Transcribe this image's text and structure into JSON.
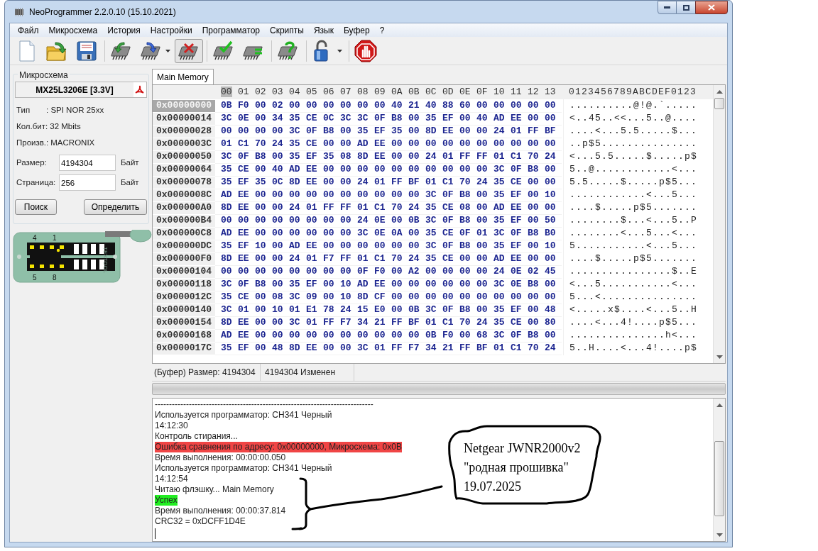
{
  "window": {
    "title": "NeoProgrammer 2.2.0.10 (15.10.2021)"
  },
  "menu": [
    "Файл",
    "Микросхема",
    "История",
    "Настройки",
    "Программатор",
    "Скрипты",
    "Язык",
    "Буфер",
    "?"
  ],
  "toolbar": [
    [
      {
        "kind": "new",
        "dropdown": false,
        "pressed": false
      },
      {
        "kind": "open",
        "dropdown": false,
        "pressed": false
      },
      {
        "kind": "save",
        "dropdown": false,
        "pressed": false
      }
    ],
    [
      {
        "kind": "read",
        "dropdown": false,
        "pressed": false
      },
      {
        "kind": "write",
        "dropdown": true,
        "pressed": false
      },
      {
        "kind": "erase",
        "dropdown": false,
        "pressed": true
      }
    ],
    [
      {
        "kind": "verify",
        "dropdown": false,
        "pressed": false
      },
      {
        "kind": "compare",
        "dropdown": false,
        "pressed": false
      }
    ],
    [
      {
        "kind": "detect",
        "dropdown": false,
        "pressed": false
      }
    ],
    [
      {
        "kind": "protect",
        "dropdown": true,
        "pressed": false
      }
    ],
    [
      {
        "kind": "stop",
        "dropdown": false,
        "pressed": false
      }
    ]
  ],
  "chip_panel": {
    "legend": "Микросхема",
    "chip_name": "MX25L3206E [3.3V]",
    "info": [
      {
        "label": "Тип",
        "value": ": SPI NOR  25xx"
      },
      {
        "label": "Кол.бит:",
        "value": "32 Mbits"
      },
      {
        "label": "Произв.:",
        "value": "MACRONIX"
      }
    ],
    "fields": [
      {
        "label": "Размер:",
        "value": "4194304",
        "unit": "Байт"
      },
      {
        "label": "Страница:",
        "value": "256",
        "unit": "Байт"
      }
    ],
    "buttons": [
      "Поиск",
      "Определить"
    ],
    "socket": {
      "pin_labels": [
        "4",
        "1",
        "5",
        "8"
      ],
      "brand": "TEXTOOL"
    }
  },
  "tabs": [
    {
      "label": "Main Memory",
      "selected": true
    }
  ],
  "hex_view": {
    "columns": [
      {
        "label": "00",
        "selected": true
      },
      {
        "label": "01",
        "selected": false
      },
      {
        "label": "02",
        "selected": false
      },
      {
        "label": "03",
        "selected": false
      },
      {
        "label": "04",
        "selected": false
      },
      {
        "label": "05",
        "selected": false
      },
      {
        "label": "06",
        "selected": false
      },
      {
        "label": "07",
        "selected": false
      },
      {
        "label": "08",
        "selected": false
      },
      {
        "label": "09",
        "selected": false
      },
      {
        "label": "0A",
        "selected": false
      },
      {
        "label": "0B",
        "selected": false
      },
      {
        "label": "0C",
        "selected": false
      },
      {
        "label": "0D",
        "selected": false
      },
      {
        "label": "0E",
        "selected": false
      },
      {
        "label": "0F",
        "selected": false
      },
      {
        "label": "10",
        "selected": false
      },
      {
        "label": "11",
        "selected": false
      },
      {
        "label": "12",
        "selected": false
      },
      {
        "label": "13",
        "selected": false
      }
    ],
    "ascii_header": "0123456789ABCDEF0123",
    "rows": [
      {
        "address": "0x00000000",
        "selected": true,
        "bytes": [
          "0B",
          "F0",
          "00",
          "02",
          "00",
          "00",
          "00",
          "00",
          "00",
          "00",
          "40",
          "21",
          "40",
          "88",
          "60",
          "00",
          "00",
          "00",
          "00",
          "00"
        ],
        "ascii": "..........@!@.`....."
      },
      {
        "address": "0x00000014",
        "selected": false,
        "bytes": [
          "3C",
          "0E",
          "00",
          "34",
          "35",
          "CE",
          "0C",
          "3C",
          "3C",
          "0F",
          "B8",
          "00",
          "35",
          "EF",
          "00",
          "40",
          "AD",
          "EE",
          "00",
          "00"
        ],
        "ascii": "<..45..<<...5..@...."
      },
      {
        "address": "0x00000028",
        "selected": false,
        "bytes": [
          "00",
          "00",
          "00",
          "00",
          "3C",
          "0F",
          "B8",
          "00",
          "35",
          "EF",
          "35",
          "00",
          "8D",
          "EE",
          "00",
          "00",
          "24",
          "01",
          "FF",
          "BF"
        ],
        "ascii": "....<...5.5.....$..."
      },
      {
        "address": "0x0000003C",
        "selected": false,
        "bytes": [
          "01",
          "C1",
          "70",
          "24",
          "35",
          "CE",
          "00",
          "00",
          "AD",
          "EE",
          "00",
          "00",
          "00",
          "00",
          "00",
          "00",
          "00",
          "00",
          "00",
          "00"
        ],
        "ascii": "..p$5..............."
      },
      {
        "address": "0x00000050",
        "selected": false,
        "bytes": [
          "3C",
          "0F",
          "B8",
          "00",
          "35",
          "EF",
          "35",
          "08",
          "8D",
          "EE",
          "00",
          "00",
          "24",
          "01",
          "FF",
          "FF",
          "01",
          "C1",
          "70",
          "24"
        ],
        "ascii": "<...5.5.....$.....p$"
      },
      {
        "address": "0x00000064",
        "selected": false,
        "bytes": [
          "35",
          "CE",
          "00",
          "40",
          "AD",
          "EE",
          "00",
          "00",
          "00",
          "00",
          "00",
          "00",
          "00",
          "00",
          "00",
          "00",
          "3C",
          "0F",
          "B8",
          "00"
        ],
        "ascii": "5..@............<..."
      },
      {
        "address": "0x00000078",
        "selected": false,
        "bytes": [
          "35",
          "EF",
          "35",
          "0C",
          "8D",
          "EE",
          "00",
          "00",
          "24",
          "01",
          "FF",
          "BF",
          "01",
          "C1",
          "70",
          "24",
          "35",
          "CE",
          "00",
          "00"
        ],
        "ascii": "5.5.....$.....p$5..."
      },
      {
        "address": "0x0000008C",
        "selected": false,
        "bytes": [
          "AD",
          "EE",
          "00",
          "00",
          "00",
          "00",
          "00",
          "00",
          "00",
          "00",
          "00",
          "00",
          "3C",
          "0F",
          "B8",
          "00",
          "35",
          "EF",
          "00",
          "10"
        ],
        "ascii": "............<...5..."
      },
      {
        "address": "0x000000A0",
        "selected": false,
        "bytes": [
          "8D",
          "EE",
          "00",
          "00",
          "24",
          "01",
          "FF",
          "FF",
          "01",
          "C1",
          "70",
          "24",
          "35",
          "CE",
          "08",
          "00",
          "AD",
          "EE",
          "00",
          "00"
        ],
        "ascii": "....$.....p$5......."
      },
      {
        "address": "0x000000B4",
        "selected": false,
        "bytes": [
          "00",
          "00",
          "00",
          "00",
          "00",
          "00",
          "00",
          "00",
          "24",
          "0E",
          "00",
          "0B",
          "3C",
          "0F",
          "B8",
          "00",
          "35",
          "EF",
          "00",
          "50"
        ],
        "ascii": "........$...<...5..P"
      },
      {
        "address": "0x000000C8",
        "selected": false,
        "bytes": [
          "AD",
          "EE",
          "00",
          "00",
          "00",
          "00",
          "00",
          "00",
          "3C",
          "0E",
          "0A",
          "00",
          "35",
          "CE",
          "0F",
          "01",
          "3C",
          "0F",
          "B8",
          "B0"
        ],
        "ascii": "........<...5...<..."
      },
      {
        "address": "0x000000DC",
        "selected": false,
        "bytes": [
          "35",
          "EF",
          "10",
          "00",
          "AD",
          "EE",
          "00",
          "00",
          "00",
          "00",
          "00",
          "00",
          "3C",
          "0F",
          "B8",
          "00",
          "35",
          "EF",
          "00",
          "10"
        ],
        "ascii": "5...........<...5..."
      },
      {
        "address": "0x000000F0",
        "selected": false,
        "bytes": [
          "8D",
          "EE",
          "00",
          "00",
          "24",
          "01",
          "F7",
          "FF",
          "01",
          "C1",
          "70",
          "24",
          "35",
          "CE",
          "00",
          "00",
          "AD",
          "EE",
          "00",
          "00"
        ],
        "ascii": "....$.....p$5......."
      },
      {
        "address": "0x00000104",
        "selected": false,
        "bytes": [
          "00",
          "00",
          "00",
          "00",
          "00",
          "00",
          "00",
          "00",
          "0F",
          "F0",
          "00",
          "A2",
          "00",
          "00",
          "00",
          "00",
          "24",
          "0E",
          "02",
          "45"
        ],
        "ascii": "................$..E"
      },
      {
        "address": "0x00000118",
        "selected": false,
        "bytes": [
          "3C",
          "0F",
          "B8",
          "00",
          "35",
          "EF",
          "00",
          "10",
          "AD",
          "EE",
          "00",
          "00",
          "00",
          "00",
          "00",
          "00",
          "3C",
          "0E",
          "B8",
          "00"
        ],
        "ascii": "<...5...........<..."
      },
      {
        "address": "0x0000012C",
        "selected": false,
        "bytes": [
          "35",
          "CE",
          "00",
          "08",
          "3C",
          "09",
          "00",
          "10",
          "8D",
          "CF",
          "00",
          "00",
          "00",
          "00",
          "00",
          "00",
          "00",
          "00",
          "00",
          "00"
        ],
        "ascii": "5...<..............."
      },
      {
        "address": "0x00000140",
        "selected": false,
        "bytes": [
          "3C",
          "01",
          "00",
          "10",
          "01",
          "E1",
          "78",
          "24",
          "15",
          "E0",
          "00",
          "0B",
          "3C",
          "0F",
          "B8",
          "00",
          "35",
          "EF",
          "00",
          "48"
        ],
        "ascii": "<.....x$....<...5..H"
      },
      {
        "address": "0x00000154",
        "selected": false,
        "bytes": [
          "8D",
          "EE",
          "00",
          "00",
          "3C",
          "01",
          "FF",
          "F7",
          "34",
          "21",
          "FF",
          "BF",
          "01",
          "C1",
          "70",
          "24",
          "35",
          "CE",
          "00",
          "80"
        ],
        "ascii": "....<...4!....p$5..."
      },
      {
        "address": "0x00000168",
        "selected": false,
        "bytes": [
          "AD",
          "EE",
          "00",
          "00",
          "00",
          "00",
          "00",
          "00",
          "00",
          "00",
          "00",
          "00",
          "0B",
          "F0",
          "00",
          "68",
          "3C",
          "0F",
          "B8",
          "00"
        ],
        "ascii": "...............h<..."
      },
      {
        "address": "0x0000017C",
        "selected": false,
        "bytes": [
          "35",
          "EF",
          "00",
          "48",
          "8D",
          "EE",
          "00",
          "00",
          "3C",
          "01",
          "FF",
          "F7",
          "34",
          "21",
          "FF",
          "BF",
          "01",
          "C1",
          "70",
          "24"
        ],
        "ascii": "5..H....<...4!....p$"
      }
    ]
  },
  "status_bar": [
    "(Буфер) Размер: 4194304",
    "4194304 Изменен"
  ],
  "progress": {
    "level": 0
  },
  "log": {
    "caret": true,
    "lines": [
      {
        "text": "-----------------------------------------------------------------------------",
        "kind": "plain"
      },
      {
        "text": "Используется программатор: CH341 Черный",
        "kind": "plain"
      },
      {
        "text": "14:12:30",
        "kind": "plain"
      },
      {
        "text": "Контроль стирания...",
        "kind": "plain"
      },
      {
        "text": "Ошибка сравнения по адресу: 0x00000000, Микросхема: 0x0B",
        "kind": "error"
      },
      {
        "text": "Время выполнения: 00:00:00.050",
        "kind": "plain"
      },
      {
        "text": "Используется программатор: CH341 Черный",
        "kind": "plain"
      },
      {
        "text": "14:12:54",
        "kind": "plain"
      },
      {
        "text": "Читаю флэшку... Main Memory",
        "kind": "plain"
      },
      {
        "text": "Успех",
        "kind": "success"
      },
      {
        "text": "Время выполнения: 00:00:37.814",
        "kind": "plain"
      },
      {
        "text": "CRC32 = 0xDCFF1D4E",
        "kind": "plain"
      }
    ]
  },
  "annotation": {
    "lines": [
      "Netgear JWNR2000v2",
      "\"родная прошивка\"",
      "19.07.2025"
    ]
  }
}
